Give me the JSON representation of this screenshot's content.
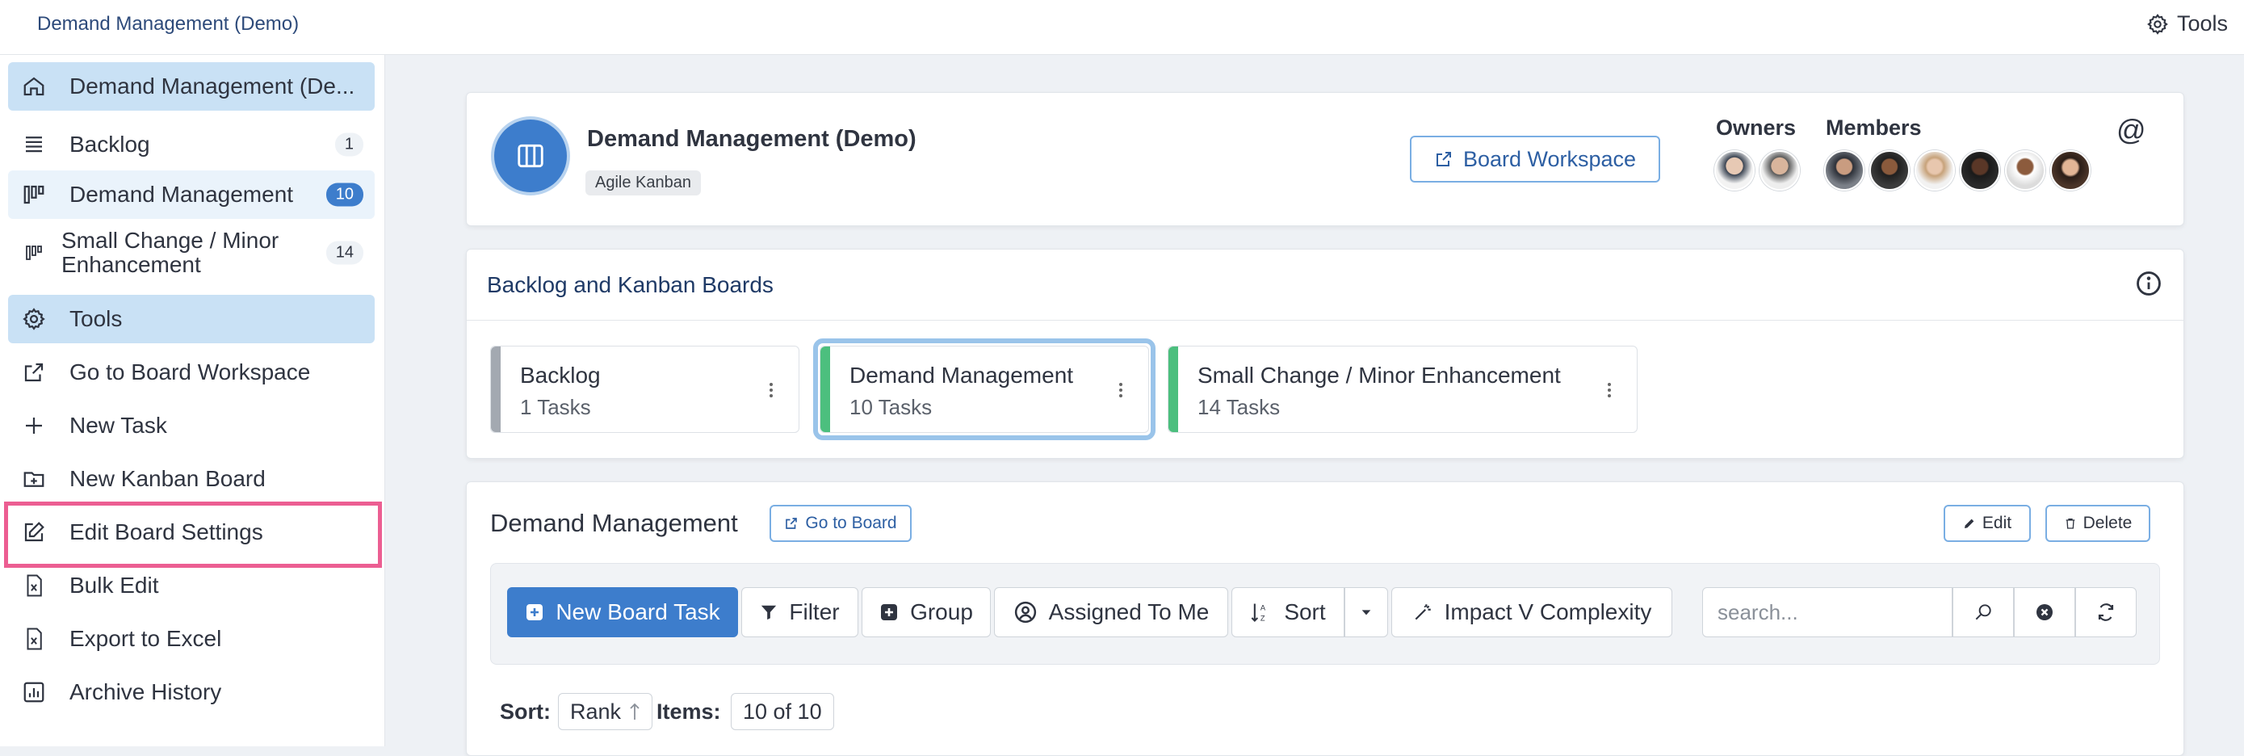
{
  "app": {
    "title": "Demand Management (Demo)",
    "tools_label": "Tools"
  },
  "sidebar": {
    "items": [
      {
        "label": "Demand Management (De...",
        "icon": "home-icon"
      },
      {
        "label": "Backlog",
        "count": "1",
        "icon": "list-icon"
      },
      {
        "label": "Demand Management",
        "count": "10",
        "icon": "kanban-icon"
      },
      {
        "label": "Small Change / Minor",
        "label2": "Enhancement",
        "count": "14",
        "icon": "kanban-icon"
      },
      {
        "label": "Tools",
        "icon": "gear-icon"
      },
      {
        "label": "Go to Board Workspace",
        "icon": "external-link-icon"
      },
      {
        "label": "New Task",
        "icon": "plus-icon"
      },
      {
        "label": "New Kanban Board",
        "icon": "folder-plus-icon"
      },
      {
        "label": "Edit Board Settings",
        "icon": "edit-icon"
      },
      {
        "label": "Bulk Edit",
        "icon": "excel-file-icon"
      },
      {
        "label": "Export to Excel",
        "icon": "excel-file-icon"
      },
      {
        "label": "Archive History",
        "icon": "chart-icon"
      }
    ]
  },
  "header_card": {
    "title": "Demand Management (Demo)",
    "tag": "Agile Kanban",
    "workspace_button": "Board Workspace",
    "owners_label": "Owners",
    "members_label": "Members",
    "at_symbol": "@"
  },
  "boards_card": {
    "title": "Backlog and Kanban Boards",
    "columns": [
      {
        "name": "Backlog",
        "count": "1 Tasks",
        "color": "#a3a9b1"
      },
      {
        "name": "Demand Management",
        "count": "10 Tasks",
        "color": "#4cbf7e"
      },
      {
        "name": "Small Change / Minor Enhancement",
        "count": "14 Tasks",
        "color": "#4cbf7e"
      }
    ]
  },
  "board_section": {
    "title": "Demand Management",
    "go_to_board": "Go to Board",
    "edit_label": "Edit",
    "delete_label": "Delete",
    "toolbar": {
      "new_task": "New Board Task",
      "filter": "Filter",
      "group": "Group",
      "assigned": "Assigned To Me",
      "sort": "Sort",
      "impact": "Impact V Complexity",
      "search_placeholder": "search..."
    },
    "sort_label": "Sort:",
    "sort_value": "Rank",
    "items_label": "Items:",
    "items_value": "10 of 10"
  },
  "colors": {
    "accent": "#3d7dcc",
    "highlight": "#ec5e92",
    "green": "#4cbf7e"
  }
}
